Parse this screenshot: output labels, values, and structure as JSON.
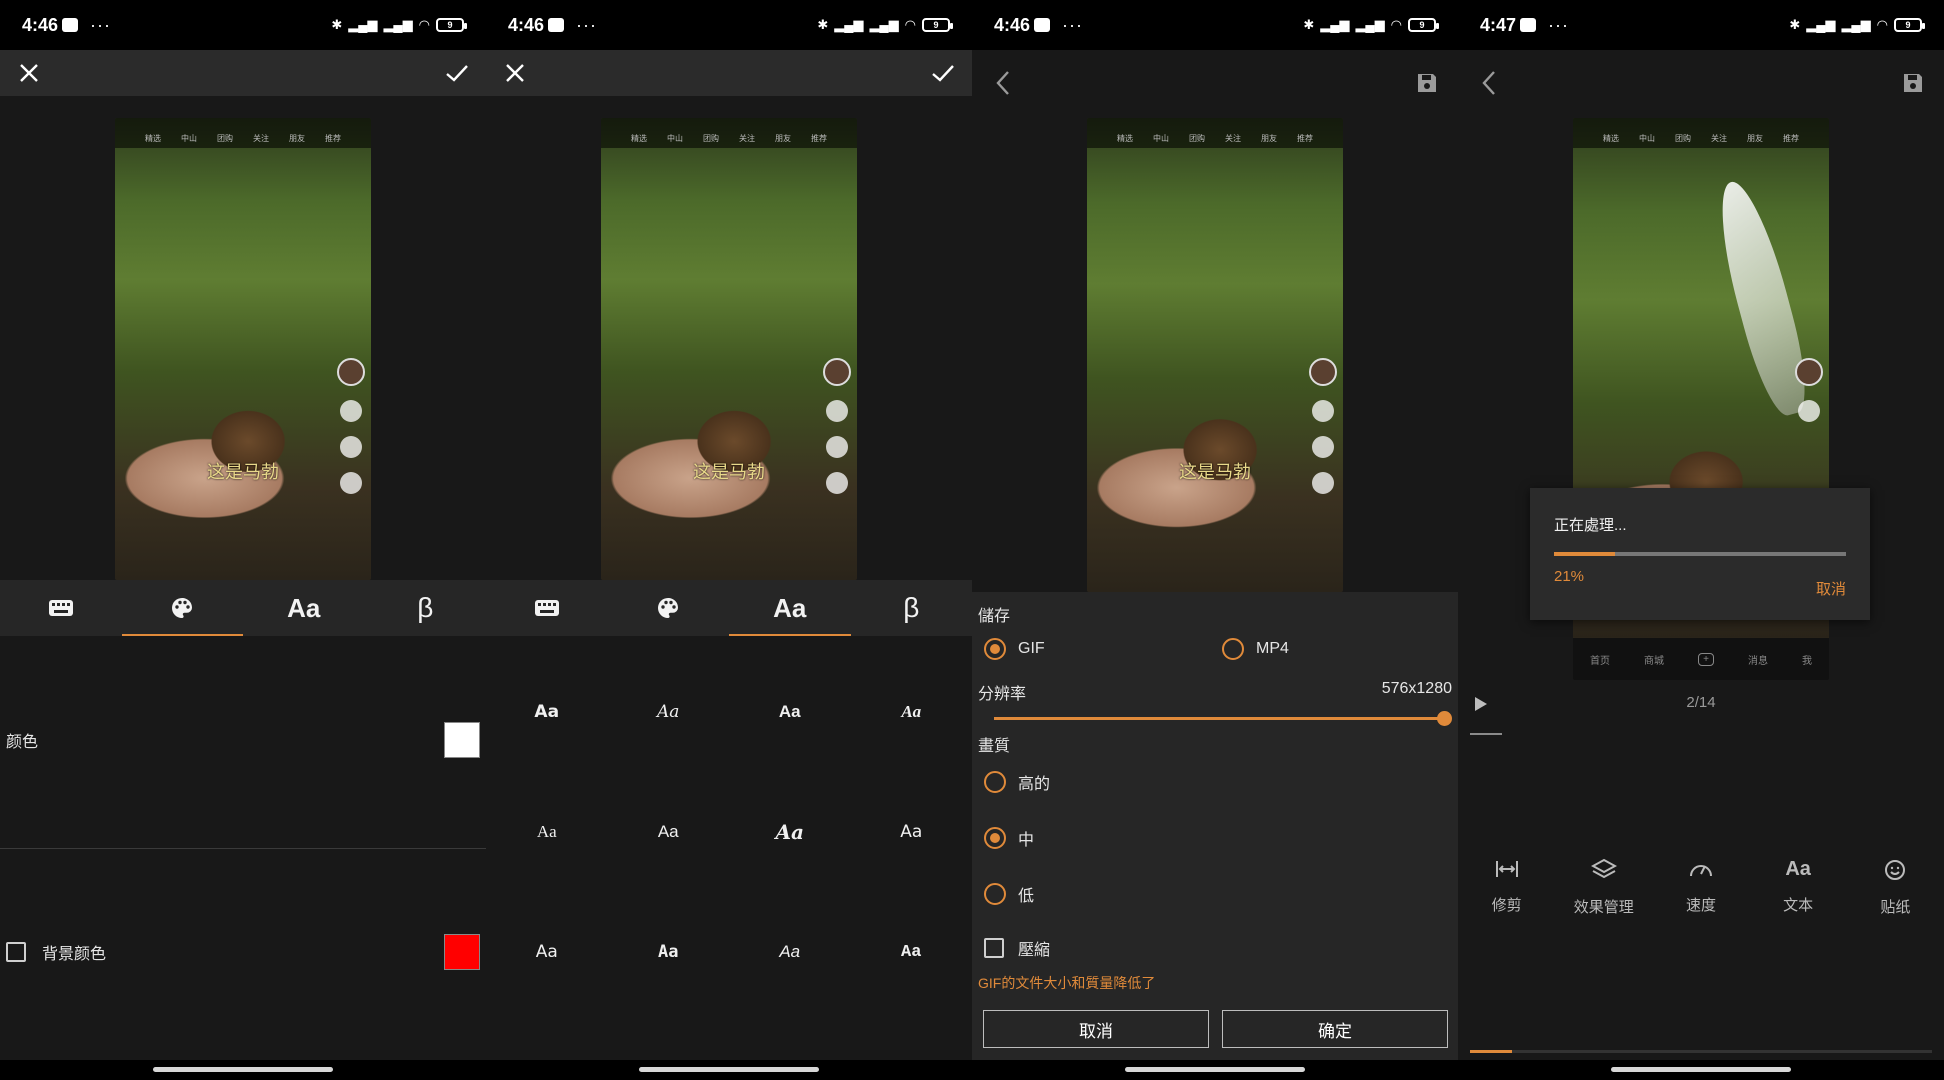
{
  "status": [
    {
      "time": "4:46",
      "dots": "···",
      "battery": "9"
    },
    {
      "time": "4:46",
      "dots": "···",
      "battery": "9"
    },
    {
      "time": "4:46",
      "dots": "···",
      "battery": "9"
    },
    {
      "time": "4:47",
      "dots": "···",
      "battery": "9"
    }
  ],
  "video": {
    "caption": "这是马勃",
    "mini_tabs": [
      "精选",
      "中山",
      "团购",
      "关注",
      "朋友",
      "推荐"
    ]
  },
  "screen1": {
    "tabs": [
      "keyboard-icon",
      "palette-icon",
      "Aa",
      "β"
    ],
    "active_tab": 1,
    "color_label": "颜色",
    "color_value": "#ffffff",
    "bg_color_label": "背景颜色",
    "bg_color_value": "#ff0000",
    "bg_color_checked": false
  },
  "screen2": {
    "tabs": [
      "keyboard-icon",
      "palette-icon",
      "Aa",
      "β"
    ],
    "active_tab": 2,
    "fonts": [
      "Aa",
      "Aa",
      "Aa",
      "Aa",
      "Aa",
      "Aa",
      "Aa",
      "Aa",
      "Aa",
      "Aa",
      "Aa",
      "Aa"
    ]
  },
  "screen3": {
    "save_label": "儲存",
    "format_gif": "GIF",
    "format_mp4": "MP4",
    "format_selected": "GIF",
    "resolution_label": "分辨率",
    "resolution_value": "576x1280",
    "resolution_fraction": 1.0,
    "quality_label": "畫質",
    "quality_high": "高的",
    "quality_mid": "中",
    "quality_low": "低",
    "quality_selected": "中",
    "compress_label": "壓縮",
    "compress_checked": false,
    "note": "GIF的文件大小和質量降低了",
    "cancel": "取消",
    "confirm": "确定",
    "accent": "#e08a3a"
  },
  "screen4": {
    "processing_label": "正在處理...",
    "progress_percent": 21,
    "progress_text": "21%",
    "cancel": "取消",
    "frame_counter": "2/14",
    "mini_nav": [
      "首页",
      "商城",
      "消息",
      "我"
    ],
    "tools": [
      {
        "icon": "trim-icon",
        "label": "修剪"
      },
      {
        "icon": "layers-icon",
        "label": "效果管理"
      },
      {
        "icon": "speed-icon",
        "label": "速度"
      },
      {
        "icon": "text-icon",
        "label": "文本"
      },
      {
        "icon": "sticker-icon",
        "label": "贴纸"
      }
    ],
    "timeline_fraction": 0.09
  }
}
